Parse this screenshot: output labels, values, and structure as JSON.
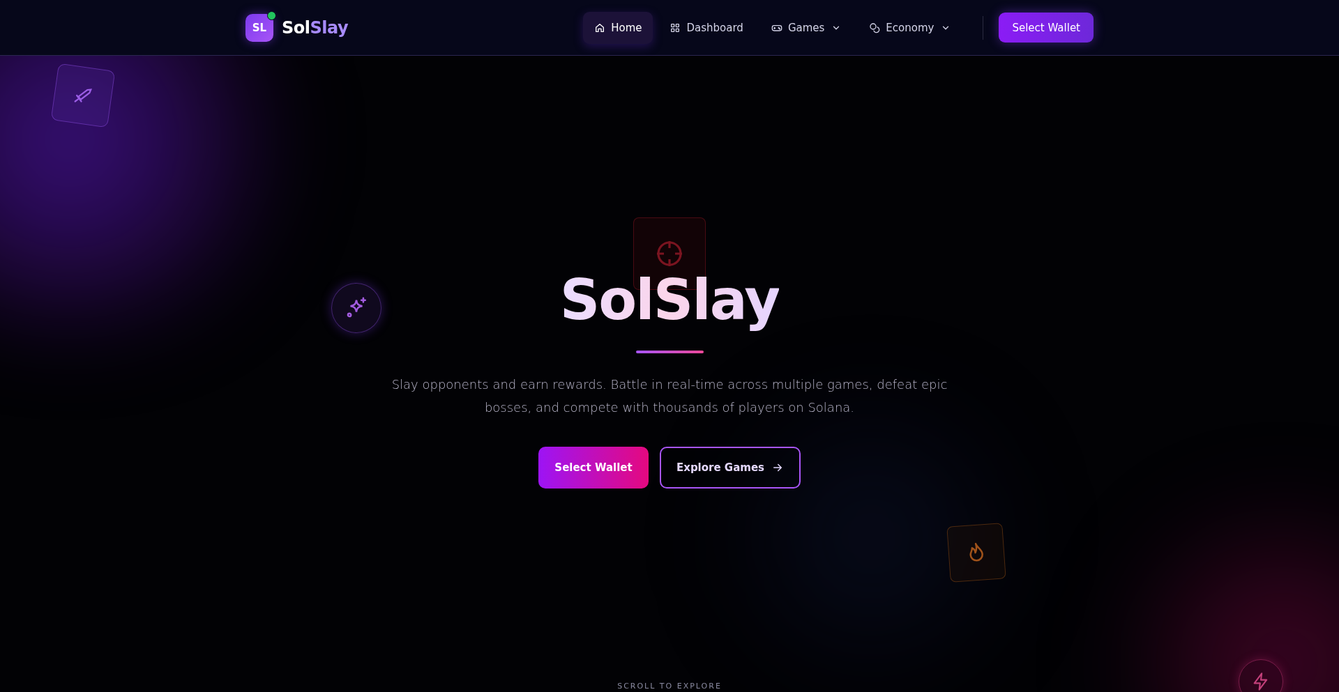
{
  "brand": {
    "badge": "SL",
    "name_part_1": "Sol",
    "name_part_2": "Slay",
    "online": true
  },
  "nav": {
    "items": [
      {
        "label": "Home",
        "selected": true,
        "dropdown": false
      },
      {
        "label": "Dashboard",
        "selected": false,
        "dropdown": false
      },
      {
        "label": "Games",
        "selected": false,
        "dropdown": true
      },
      {
        "label": "Economy",
        "selected": false,
        "dropdown": true
      }
    ],
    "wallet_button": "Select Wallet"
  },
  "hero": {
    "title": "SolSlay",
    "subtitle": "Slay opponents and earn rewards. Battle in real-time across multiple games, defeat epic bosses, and compete with thousands of players on Solana.",
    "buttons": [
      {
        "label": "Select Wallet",
        "kind": "primary"
      },
      {
        "label": "Explore Games",
        "kind": "outline"
      }
    ],
    "scroll_hint": "SCROLL TO EXPLORE"
  }
}
